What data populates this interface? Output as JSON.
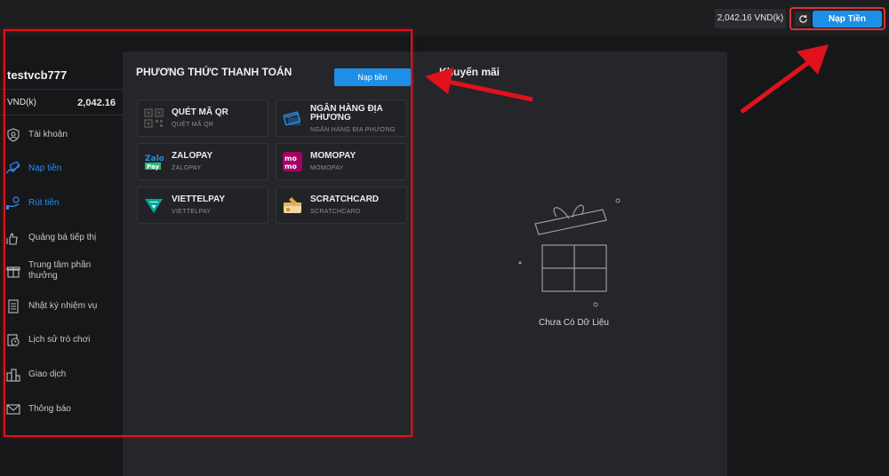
{
  "topbar": {
    "balance": "2,042.16 VND(k)",
    "deposit_label": "Nạp Tiền"
  },
  "sidebar": {
    "username": "testvcb777",
    "currency": "VND(k)",
    "balance": "2,042.16",
    "items": [
      {
        "label": "Tài khoản",
        "icon": "user-shield-icon"
      },
      {
        "label": "Nạp tiền",
        "icon": "deposit-icon",
        "active": true
      },
      {
        "label": "Rút tiền",
        "icon": "withdraw-icon",
        "active": true
      },
      {
        "label": "Quảng bá tiếp thị",
        "icon": "promote-hand-icon"
      },
      {
        "label": "Trung tâm phần thưởng",
        "icon": "gift-icon"
      },
      {
        "label": "Nhật ký nhiệm vụ",
        "icon": "task-log-icon"
      },
      {
        "label": "Lịch sử trò chơi",
        "icon": "game-history-icon"
      },
      {
        "label": "Giao dịch",
        "icon": "transaction-icon"
      },
      {
        "label": "Thông báo",
        "icon": "mail-icon"
      }
    ]
  },
  "payment": {
    "title": "PHƯƠNG THỨC THANH TOÁN",
    "deposit_label": "Nạp tiền",
    "methods": [
      {
        "name": "QUÉT MÃ QR",
        "sub": "QUÉT MÃ QR",
        "icon": "qr-code-icon"
      },
      {
        "name": "NGÂN HÀNG ĐỊA PHƯƠNG",
        "sub": "NGÂN HÀNG ĐỊA PHƯƠNG",
        "icon": "bank-card-icon"
      },
      {
        "name": "ZALOPAY",
        "sub": "ZALOPAY",
        "icon": "zalopay-logo-icon"
      },
      {
        "name": "MOMOPAY",
        "sub": "MOMOPAY",
        "icon": "momo-logo-icon"
      },
      {
        "name": "VIETTELPAY",
        "sub": "VIETTELPAY",
        "icon": "viettelpay-logo-icon"
      },
      {
        "name": "SCRATCHCARD",
        "sub": "SCRATCHCARD",
        "icon": "scratchcard-icon"
      }
    ]
  },
  "promo": {
    "title": "Khuyến mãi",
    "empty_text": "Chưa Có Dữ Liệu"
  },
  "colors": {
    "accent": "#1e8fe6",
    "annotation_red": "#e0121b",
    "panel": "#25262a",
    "background": "#161719"
  }
}
